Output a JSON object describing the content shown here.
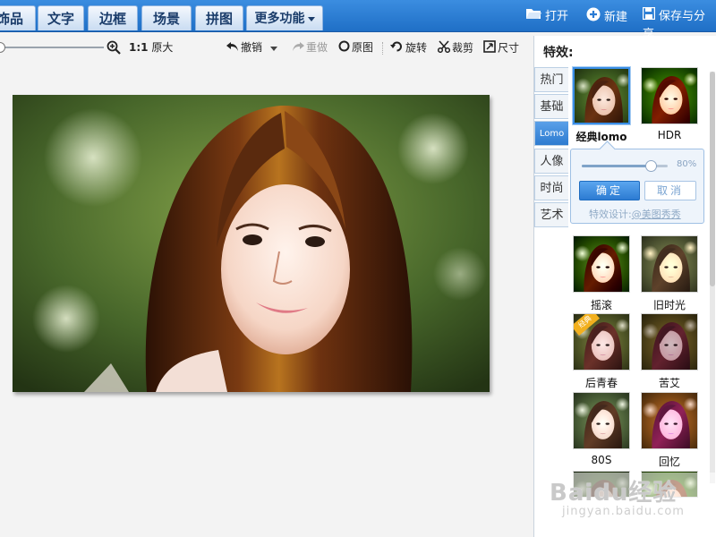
{
  "nav": {
    "tabs": [
      "饰品",
      "文字",
      "边框",
      "场景",
      "拼图"
    ],
    "more_label": "更多功能",
    "actions": {
      "open": "打开",
      "new": "新建",
      "save_share": "保存与分享"
    }
  },
  "toolbar": {
    "zoom_ratio": "1:1",
    "actual_size": "原大",
    "undo": "撤销",
    "redo": "重做",
    "original": "原图",
    "rotate": "旋转",
    "crop": "裁剪",
    "resize": "尺寸"
  },
  "panel": {
    "title": "特效:",
    "categories": [
      "热门",
      "基础",
      "Lomo",
      "人像",
      "时尚",
      "艺术"
    ],
    "active_category": "Lomo",
    "effects": [
      {
        "label": "经典lomo",
        "selected": true
      },
      {
        "label": "HDR"
      },
      {
        "label": "摇滚"
      },
      {
        "label": "旧时光"
      },
      {
        "label": "后青春",
        "badge": "经典"
      },
      {
        "label": "苦艾"
      },
      {
        "label": "80S"
      },
      {
        "label": "回忆"
      }
    ]
  },
  "popup": {
    "value": "80%",
    "level": 0.8,
    "ok": "确定",
    "cancel": "取消",
    "credit_prefix": "特效设计:",
    "credit_link": "@美图秀秀"
  },
  "watermark": {
    "logo": "Baidu经验",
    "url": "jingyan.baidu.com"
  },
  "colors": {
    "nav_blue": "#2a7bd4",
    "accent": "#3a8ee6"
  }
}
